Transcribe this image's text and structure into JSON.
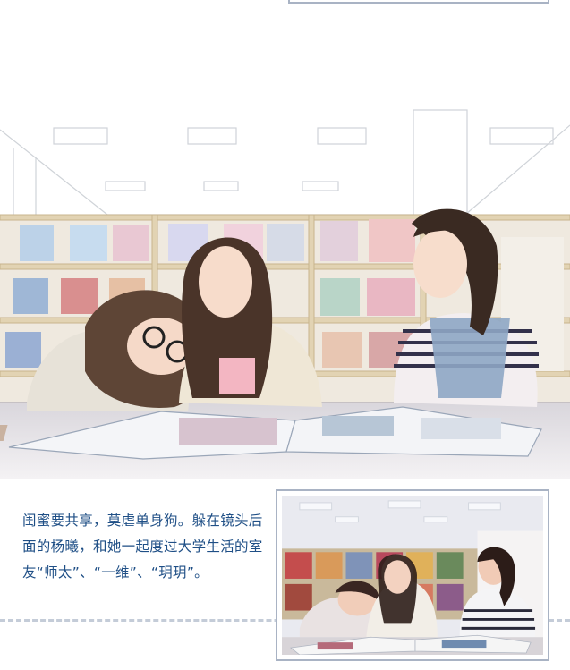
{
  "caption": {
    "text": "闺蜜要共享，莫虐单身狗。躲在镜头后面的杨曦，和她一起度过大学生活的室友“师太”、“一维”、“玥玥”。"
  },
  "colors": {
    "caption_text": "#1f4f86",
    "frame_border": "#a9b3c4",
    "dash_line": "#c4ccd8"
  },
  "illustration": {
    "subject": "three-girls-library-sketch"
  },
  "photo": {
    "subject": "three-girls-library-photo"
  }
}
